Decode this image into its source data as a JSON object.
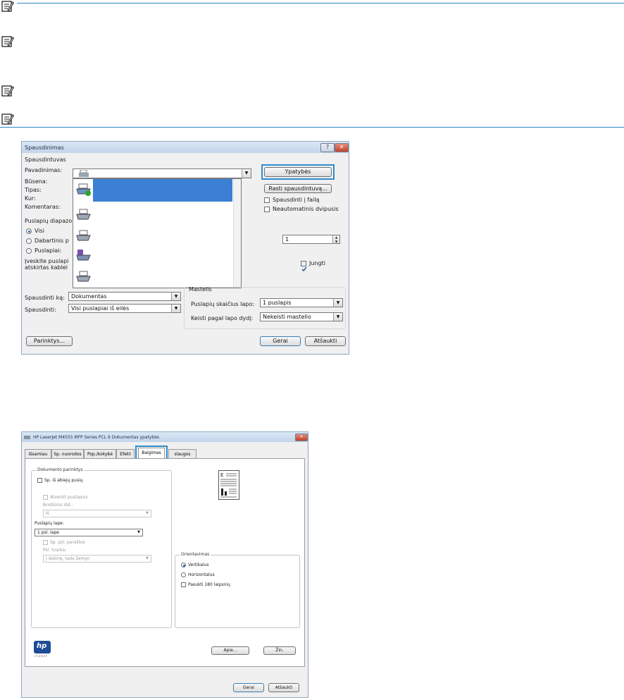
{
  "print_dialog": {
    "title": "Spausdinimas",
    "help_btn": "?",
    "close_btn": "✕",
    "printer_group": "Spausdintuvas",
    "name_label": "Pavadinimas:",
    "status_label": "Būsena:",
    "type_label": "Tipas:",
    "where_label": "Kur:",
    "comment_label": "Komentaras:",
    "properties_btn": "Ypatybės",
    "find_printer_btn": "Rasti spausdintuvą...",
    "print_to_file": "Spausdinti į failą",
    "manual_duplex": "Neautomatinis dvipusis",
    "range_group": "Puslapių diapazo",
    "range_all": "Visi",
    "range_current": "Dabartinis p",
    "range_pages": "Puslapiai:",
    "range_hint1": "Įveskite puslapi",
    "range_hint2": "atskirtas kablel",
    "copies_value": "1",
    "collate": "Jungti",
    "zoom_group": "Mastelis",
    "print_what_label": "Spausdinti ką:",
    "print_what_value": "Dokumentas",
    "print_label": "Spausdinti:",
    "print_value": "Visi puslapiai iš eilės",
    "pages_per_sheet_label": "Puslapių skaičius lapo:",
    "pages_per_sheet_value": "1 puslapis",
    "scale_label": "Keisti pagal lapo dydį:",
    "scale_value": "Nekeisti mastelio",
    "options_btn": "Parinktys...",
    "ok_btn": "Gerai",
    "cancel_btn": "Atšaukti"
  },
  "props_dialog": {
    "title": "HP LaserJet M4555 MFP Series PCL 6 Dokumentas ypatybės",
    "tabs": [
      "Išsamiau",
      "Sp. nuorodos",
      "Pop./kokybė",
      "Efekt",
      "Baigimas",
      "slaugos"
    ],
    "doc_options_group": "Dokumento parinktys",
    "print_both_sides": "Sp. iš abiejų pusių",
    "flip_pages": "Atversti puslapius",
    "booklet_label": "Brošiūros išd.:",
    "booklet_value": "Iš",
    "pages_per_sheet_label": "Puslapių lape:",
    "pages_per_sheet_value": "1 psl. lape",
    "print_borders": "Sp. psl. paraštes",
    "order_label": "Psl. tvarka:",
    "order_value": "Į dešinę, tada žemyn",
    "orientation_group": "Orientavimas",
    "portrait": "Vertikalus",
    "landscape": "Horizontalus",
    "rotate": "Pasukti 180 laipsnių",
    "about_btn": "Apie...",
    "help_btn": "Žin.",
    "ok_btn": "Gerai",
    "cancel_btn": "Atšaukti",
    "logo_text": "hp",
    "logo_sub": "invent"
  }
}
